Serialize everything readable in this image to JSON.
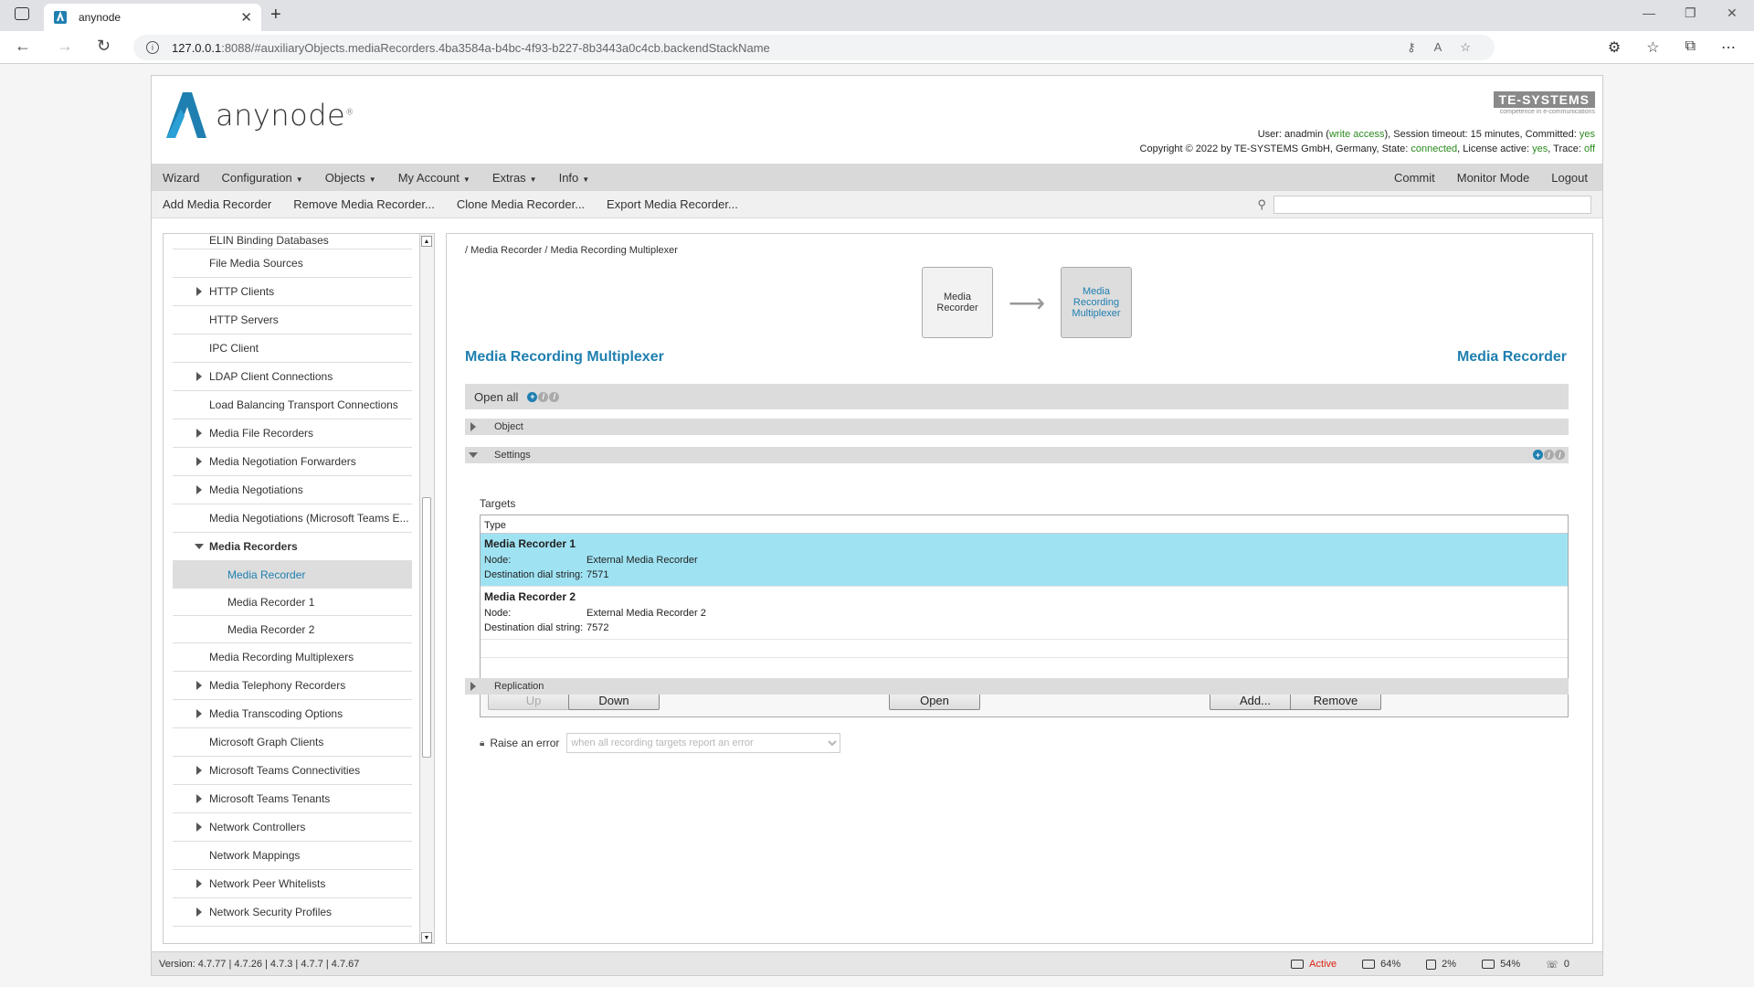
{
  "browser": {
    "tab_title": "anynode",
    "url_host": "127.0.0.1",
    "url_path": ":8088/#auxiliaryObjects.mediaRecorders.4ba3584a-b4bc-4f93-b227-8b3443a0c4cb.backendStackName"
  },
  "header": {
    "logo_text": "anynode",
    "te_logo": "TE-SYSTEMS",
    "te_sub": "competence in e-communications",
    "session_line1_prefix": "User: anadmin (",
    "session_access": "write access",
    "session_line1_mid": "), Session timeout: 15 minutes, Committed: ",
    "session_committed": "yes",
    "session_line2_prefix": "Copyright © 2022 by TE-SYSTEMS GmbH, Germany, State: ",
    "session_state": "connected",
    "session_line2_mid": ", License active: ",
    "session_license": "yes",
    "session_line2_trace": ", Trace: ",
    "session_trace": "off"
  },
  "menu": {
    "items": [
      "Wizard",
      "Configuration",
      "Objects",
      "My Account",
      "Extras",
      "Info"
    ],
    "right": [
      "Commit",
      "Monitor Mode",
      "Logout"
    ]
  },
  "toolbar": {
    "items": [
      "Add Media Recorder",
      "Remove Media Recorder...",
      "Clone Media Recorder...",
      "Export Media Recorder..."
    ]
  },
  "sidebar": {
    "items": [
      {
        "label": "ELIN Binding Databases",
        "expandable": false
      },
      {
        "label": "File Media Sources",
        "expandable": false
      },
      {
        "label": "HTTP Clients",
        "expandable": true
      },
      {
        "label": "HTTP Servers",
        "expandable": false
      },
      {
        "label": "IPC Client",
        "expandable": false
      },
      {
        "label": "LDAP Client Connections",
        "expandable": true
      },
      {
        "label": "Load Balancing Transport Connections",
        "expandable": false
      },
      {
        "label": "Media File Recorders",
        "expandable": true
      },
      {
        "label": "Media Negotiation Forwarders",
        "expandable": true
      },
      {
        "label": "Media Negotiations",
        "expandable": true
      },
      {
        "label": "Media Negotiations (Microsoft Teams E...",
        "expandable": false
      },
      {
        "label": "Media Recorders",
        "expandable": true
      },
      {
        "label": "Media Recorder",
        "expandable": false
      },
      {
        "label": "Media Recorder 1",
        "expandable": false
      },
      {
        "label": "Media Recorder 2",
        "expandable": false
      },
      {
        "label": "Media Recording Multiplexers",
        "expandable": false
      },
      {
        "label": "Media Telephony Recorders",
        "expandable": true
      },
      {
        "label": "Media Transcoding Options",
        "expandable": true
      },
      {
        "label": "Microsoft Graph Clients",
        "expandable": false
      },
      {
        "label": "Microsoft Teams Connectivities",
        "expandable": true
      },
      {
        "label": "Microsoft Teams Tenants",
        "expandable": true
      },
      {
        "label": "Network Controllers",
        "expandable": true
      },
      {
        "label": "Network Mappings",
        "expandable": false
      },
      {
        "label": "Network Peer Whitelists",
        "expandable": true
      },
      {
        "label": "Network Security Profiles",
        "expandable": true
      }
    ]
  },
  "main": {
    "breadcrumb": "/ Media Recorder / Media Recording Multiplexer",
    "flow_left": "Media Recorder",
    "flow_right": "Media Recording Multiplexer",
    "heading_left": "Media Recording Multiplexer",
    "heading_right": "Media Recorder",
    "open_all": "Open all",
    "section_object": "Object",
    "section_settings": "Settings",
    "section_replication": "Replication",
    "targets_label": "Targets",
    "table_header": "Type",
    "node_key": "Node:",
    "dial_key": "Destination dial string:",
    "rows": [
      {
        "name": "Media Recorder 1",
        "node": "External Media Recorder",
        "dial": "7571"
      },
      {
        "name": "Media Recorder 2",
        "node": "External Media Recorder 2",
        "dial": "7572"
      }
    ],
    "buttons": {
      "up": "Up",
      "down": "Down",
      "open": "Open",
      "add": "Add...",
      "remove": "Remove"
    },
    "raise_label": "Raise an error",
    "raise_value": "when all recording targets report an error"
  },
  "footer": {
    "version": "Version:  4.7.77  |  4.7.26  |  4.7.3  |  4.7.7  |  4.7.67",
    "status": "Active",
    "disk": "64%",
    "cpu": "2%",
    "mem": "54%",
    "calls": "0"
  },
  "colors": {
    "accent": "#1f7fb0",
    "selected_row": "#9fe3f3",
    "active": "#dd2211",
    "ok": "#2c8a1f"
  }
}
